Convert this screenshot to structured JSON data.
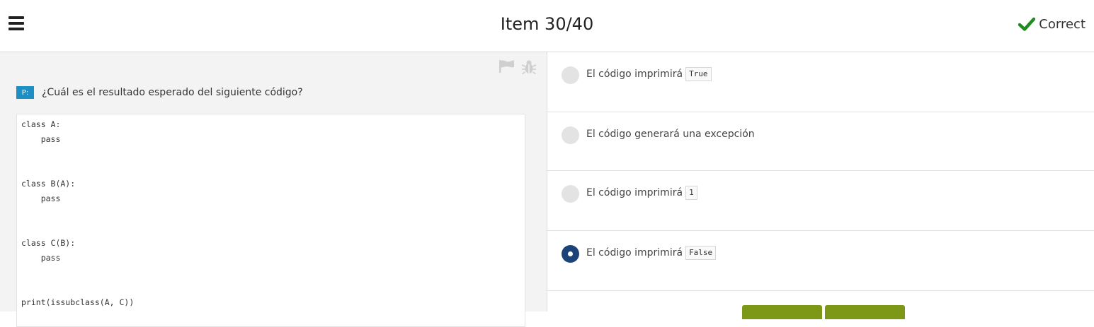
{
  "header": {
    "title": "Item 30/40",
    "status": "Correct",
    "status_color": "#1e8c1e"
  },
  "question": {
    "badge": "P:",
    "text": "¿Cuál es el resultado esperado del siguiente código?",
    "code_lines": [
      "class A:",
      "    pass",
      "",
      "",
      "class B(A):",
      "    pass",
      "",
      "",
      "class C(B):",
      "    pass",
      "",
      "",
      "print(issubclass(A, C))"
    ]
  },
  "answers": [
    {
      "prefix": "El código imprimirá",
      "code": "True",
      "selected": false
    },
    {
      "prefix": "El código generará una excepción",
      "code": "",
      "selected": false
    },
    {
      "prefix": "El código imprimirá",
      "code": "1",
      "selected": false
    },
    {
      "prefix": "El código imprimirá",
      "code": "False",
      "selected": true
    }
  ],
  "colors": {
    "badge": "#1d8fc4",
    "selected_radio": "#1c4377",
    "button": "#7d9817"
  },
  "icons": {
    "menu": "hamburger-menu-icon",
    "status": "checkmark-icon",
    "flag": "flag-icon",
    "bug": "bug-icon"
  }
}
